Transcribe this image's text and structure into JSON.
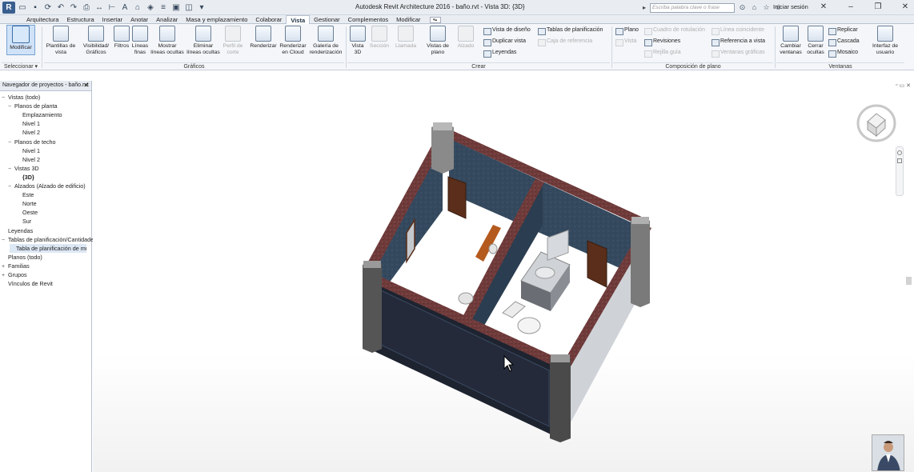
{
  "app": {
    "logo": "R",
    "title": "Autodesk Revit Architecture 2016 -    baño.rvt - Vista 3D: {3D}",
    "search_placeholder": "Escriba palabra clave o frase",
    "sign_in": "Iniciar sesión"
  },
  "tabs": [
    "Arquitectura",
    "Estructura",
    "Insertar",
    "Anotar",
    "Analizar",
    "Masa y emplazamiento",
    "Colaborar",
    "Vista",
    "Gestionar",
    "Complementos",
    "Modificar"
  ],
  "active_tab": "Vista",
  "ribbon": {
    "select": {
      "modify": "Modificar",
      "panel": "Seleccionar"
    },
    "graphics": {
      "view_templates": [
        "Plantillas de",
        "vista"
      ],
      "visibility": [
        "Visibilidad/",
        "Gráficos"
      ],
      "filters": [
        "Filtros",
        ""
      ],
      "thin_lines": [
        "Líneas",
        "finas"
      ],
      "show_hidden": [
        "Mostrar",
        "líneas ocultas"
      ],
      "remove_hidden": [
        "Eliminar",
        "líneas ocultas"
      ],
      "cut_profile": [
        "Perfil de",
        "corte"
      ],
      "render": [
        "Renderizar",
        ""
      ],
      "render_cloud": [
        "Renderizar",
        "en Cloud"
      ],
      "render_gallery": [
        "Galería de",
        "renderización"
      ],
      "panel": "Gráficos"
    },
    "create": {
      "view_3d": [
        "Vista",
        "3D"
      ],
      "section": [
        "Sección",
        ""
      ],
      "callout": [
        "Llamada",
        ""
      ],
      "plan_views": [
        "Vistas de",
        "plano"
      ],
      "elevation": [
        "Alzado",
        ""
      ],
      "drafting_view": "Vista de diseño",
      "duplicate_view": "Duplicar vista",
      "legends": "Leyendas",
      "schedules": "Tablas de planificación",
      "scope_box": "Caja de referencia",
      "panel": "Crear"
    },
    "sheet": {
      "sheet": "Plano",
      "view": "Vista",
      "title_block": "Cuadro de rotulación",
      "revisions": "Revisiones",
      "guide_grid": "Rejilla guía",
      "matchline": "Línea coincidente",
      "view_reference": "Referencia a vista",
      "viewports": "Ventanas gráficas",
      "panel": "Composición de plano"
    },
    "windows": {
      "switch": [
        "Cambiar",
        "ventanas"
      ],
      "close_hidden": [
        "Cerrar",
        "ocultas"
      ],
      "replicate": "Replicar",
      "cascade": "Cascada",
      "tile": "Mosaico",
      "ui": [
        "Interfaz de",
        "usuario"
      ],
      "panel": "Ventanas"
    }
  },
  "browser": {
    "title": "Navegador de proyectos - baño.rvt",
    "rows": [
      {
        "label": "Vistas (todo)",
        "exp": "−"
      },
      {
        "label": "Planos de planta",
        "exp": "−"
      },
      {
        "label": "Emplazamiento",
        "exp": ""
      },
      {
        "label": "Nivel 1",
        "exp": ""
      },
      {
        "label": "Nivel 2",
        "exp": ""
      },
      {
        "label": "Planos de techo",
        "exp": "−"
      },
      {
        "label": "Nivel 1",
        "exp": ""
      },
      {
        "label": "Nivel 2",
        "exp": ""
      },
      {
        "label": "Vistas 3D",
        "exp": "−"
      },
      {
        "label": "{3D}",
        "exp": ""
      },
      {
        "label": "Alzados (Alzado de edificio)",
        "exp": "−"
      },
      {
        "label": "Este",
        "exp": ""
      },
      {
        "label": "Norte",
        "exp": ""
      },
      {
        "label": "Oeste",
        "exp": ""
      },
      {
        "label": "Sur",
        "exp": ""
      },
      {
        "label": "Leyendas",
        "exp": ""
      },
      {
        "label": "Tablas de planificación/Cantidades",
        "exp": "−"
      },
      {
        "label": "Tabla de planificación de multicategoría",
        "exp": ""
      },
      {
        "label": "Planos (todo)",
        "exp": ""
      },
      {
        "label": "Familias",
        "exp": "+"
      },
      {
        "label": "Grupos",
        "exp": "+"
      },
      {
        "label": "Vínculos de Revit",
        "exp": ""
      }
    ]
  },
  "colors": {
    "wall_tile": "#34495e",
    "brick": "#6e3a3a",
    "column": "#8a8a8a",
    "floor": "#ffffff",
    "door": "#5a2e1a"
  }
}
